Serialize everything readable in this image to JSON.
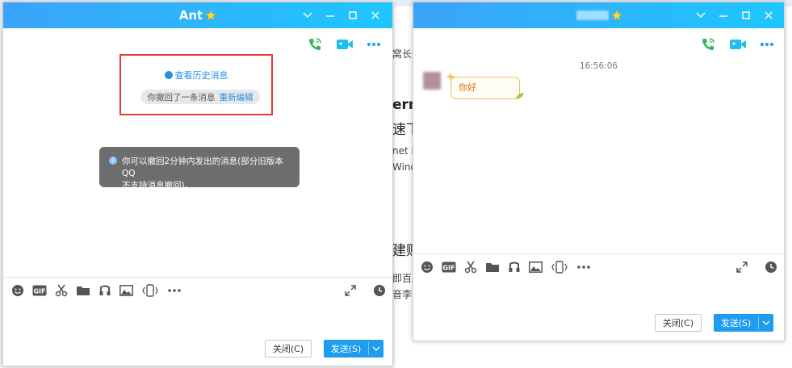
{
  "colors": {
    "title_start": "#3ba3f9",
    "title_end": "#1ec6ff",
    "accent": "#1e9cf0",
    "highlight": "#e53935",
    "icon_green": "#2fb95b"
  },
  "background_page": {
    "fragments": [
      "窝长大",
      "erne",
      "速下",
      "net D",
      "Windc",
      "建贴",
      "即百度",
      "音李荫"
    ]
  },
  "left_window": {
    "title": "Ant",
    "title_icon": "star-icon",
    "controls": [
      "chevron-down-icon",
      "minimize-icon",
      "maximize-icon",
      "close-icon"
    ],
    "top_actions": [
      "voice-call-icon",
      "video-call-icon",
      "more-icon"
    ],
    "history_link": "查看历史消息",
    "recall_notice": "你撤回了一条消息",
    "reedit_link": "重新编辑",
    "tip_line1": "你可以撤回2分钟内发出的消息(部分旧版本QQ",
    "tip_line2": "不支持消息撤回)。",
    "toolbar": [
      "emoji-icon",
      "gif-icon",
      "scissors-icon",
      "folder-icon",
      "music-icon",
      "image-icon",
      "shake-icon",
      "more-icon"
    ],
    "close_button": "关闭(C)",
    "send_button": "发送(S)"
  },
  "right_window": {
    "title_icon": "star-icon",
    "controls": [
      "chevron-down-icon",
      "minimize-icon",
      "maximize-icon",
      "close-icon"
    ],
    "top_actions": [
      "voice-call-icon",
      "video-call-icon",
      "more-icon"
    ],
    "timestamp": "16:56:06",
    "message": "你好",
    "toolbar": [
      "emoji-icon",
      "gif-icon",
      "scissors-icon",
      "folder-icon",
      "music-icon",
      "image-icon",
      "shake-icon",
      "more-icon"
    ],
    "close_button": "关闭(C)",
    "send_button": "发送(S)"
  }
}
